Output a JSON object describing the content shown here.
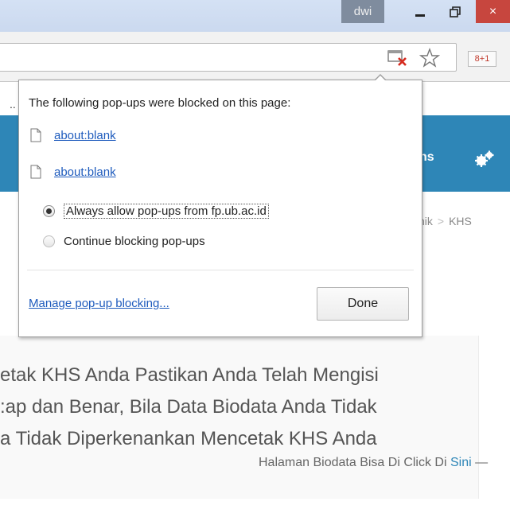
{
  "window": {
    "user": "dwi",
    "close_glyph": "×"
  },
  "toolbar": {
    "gplus_label": "8+1",
    "blocked_icon": "popup-blocked-icon",
    "star_icon": "star-icon"
  },
  "page": {
    "nav_partial": "ns",
    "breadcrumb": [
      "nik",
      "KHS"
    ],
    "content_lines": [
      "etak KHS Anda Pastikan Anda Telah Mengisi",
      ":ap dan Benar, Bila Data Biodata Anda Tidak",
      "a Tidak Diperkenankan Mencetak KHS Anda"
    ],
    "source_prefix": "Halaman Biodata Bisa Di Click Di ",
    "source_link": "Sini",
    "source_suffix": " —",
    "colors": {
      "navbar": "#2e86b7",
      "link": "#1e5bbd"
    }
  },
  "popup": {
    "ellipsis": "..",
    "heading": "The following pop-ups were blocked on this page:",
    "blocked_items": [
      "about:blank",
      "about:blank"
    ],
    "options": [
      {
        "label": "Always allow pop-ups from fp.ub.ac.id",
        "selected": true
      },
      {
        "label": "Continue blocking pop-ups",
        "selected": false
      }
    ],
    "manage_link": "Manage pop-up blocking...",
    "done_label": "Done"
  }
}
